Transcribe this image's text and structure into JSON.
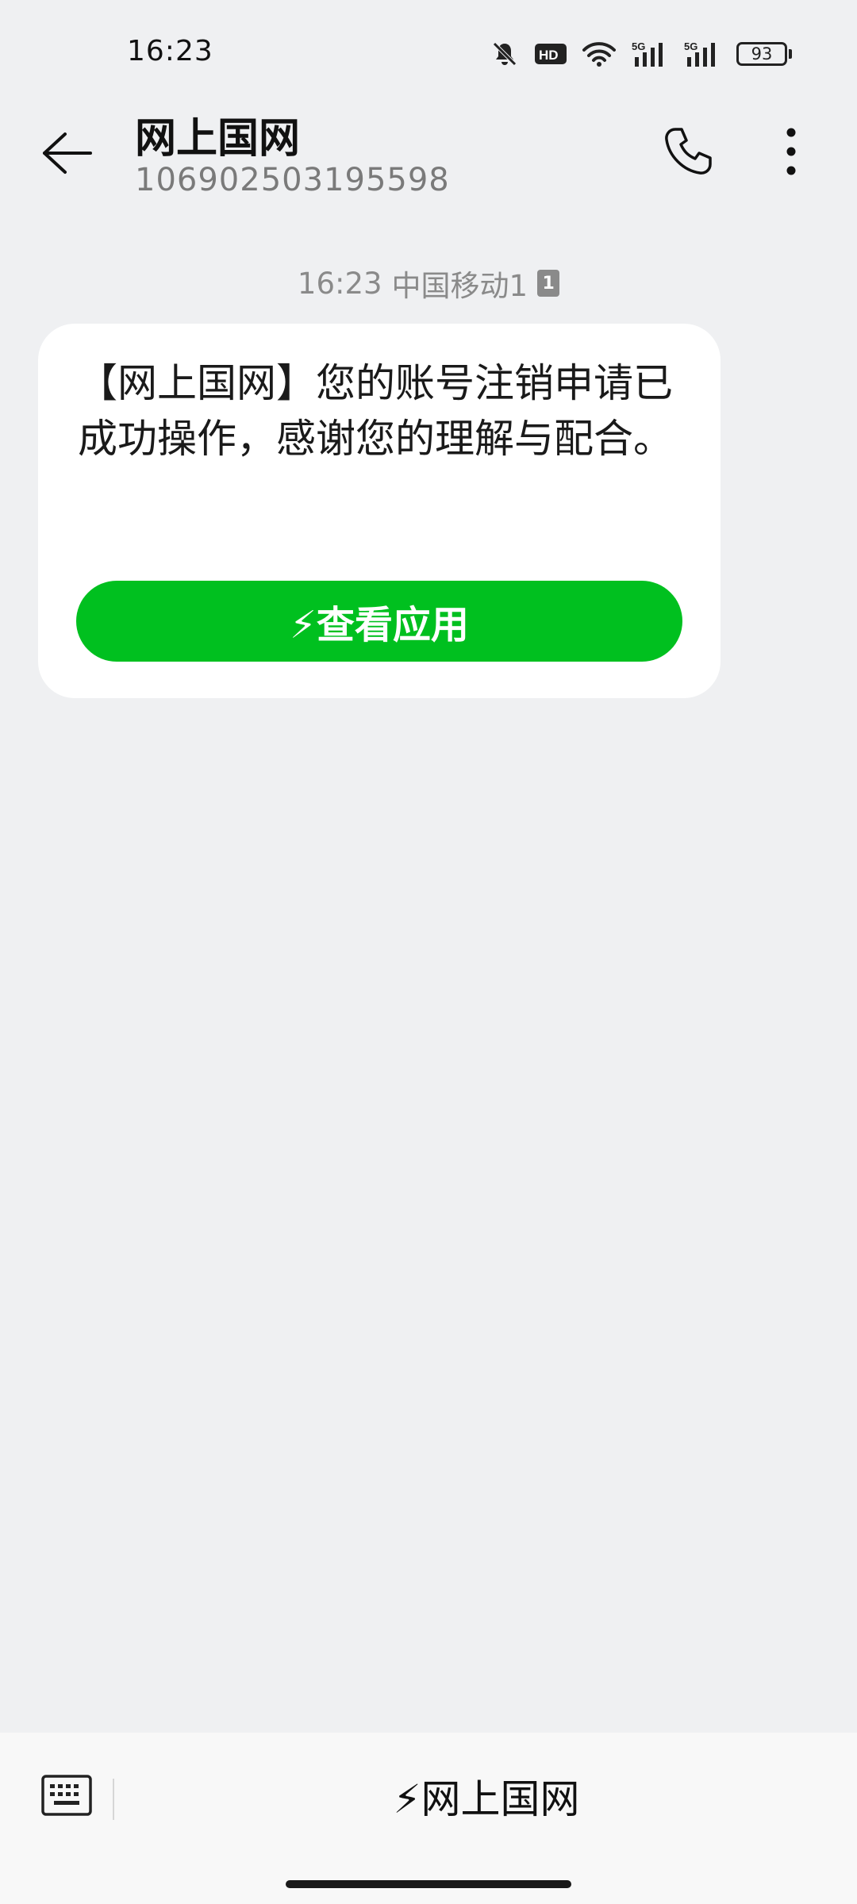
{
  "status_bar": {
    "time": "16:23",
    "icons": [
      "bell-muted-icon",
      "hd-icon",
      "wifi-icon",
      "5g-signal-icon",
      "5g-signal-icon"
    ],
    "battery": "93"
  },
  "header": {
    "contact_name": "网上国网",
    "contact_number": "106902503195598",
    "back_icon": "arrow-left-icon",
    "call_icon": "phone-icon",
    "more_icon": "more-vertical-icon"
  },
  "message": {
    "time": "16:23",
    "sim_label": "中国移动1",
    "sim_badge": "1",
    "text": "【网上国网】您的账号注销申请已成功操作，感谢您的理解与配合。",
    "action_button": "⚡查看应用"
  },
  "bottom_bar": {
    "keyboard_icon": "keyboard-icon",
    "menu_label": "⚡网上国网"
  },
  "colors": {
    "background": "#eff0f2",
    "bubble": "#ffffff",
    "accent_green": "#00c01f"
  }
}
